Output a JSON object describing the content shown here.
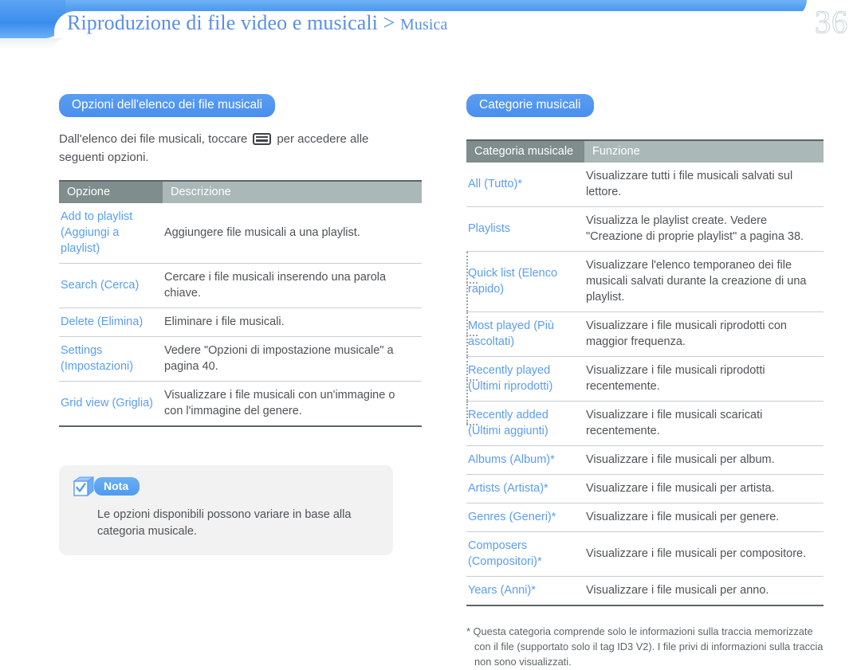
{
  "header": {
    "breadcrumb_main": "Riproduzione di file video e musicali > ",
    "breadcrumb_sub": "Musica",
    "page_number": "36"
  },
  "left": {
    "section_title": "Opzioni dell'elenco dei file musicali",
    "intro_before": "Dall'elenco dei file musicali, toccare",
    "intro_after": "per accedere alle seguenti opzioni.",
    "menu_icon_name": "options-menu-icon",
    "table": {
      "headers": [
        "Opzione",
        "Descrizione"
      ],
      "rows": [
        {
          "key": "Add to playlist (Aggiungi a playlist)",
          "value": "Aggiungere file musicali a una playlist."
        },
        {
          "key": "Search (Cerca)",
          "value": "Cercare i file musicali inserendo una parola chiave."
        },
        {
          "key": "Delete (Elimina)",
          "value": "Eliminare i file musicali."
        },
        {
          "key": "Settings (Impostazioni)",
          "value": "Vedere \"Opzioni di impostazione musicale\" a pagina  40."
        },
        {
          "key": "Grid view (Griglia)",
          "value": "Visualizzare i file musicali con un'immagine o con l'immagine del genere."
        }
      ]
    },
    "note": {
      "icon_name": "note-cube-check-icon",
      "label": "Nota",
      "text": "Le opzioni disponibili possono variare in base alla categoria musicale."
    }
  },
  "right": {
    "section_title": "Categorie musicali",
    "table": {
      "headers": [
        "Categoria musicale",
        "Funzione"
      ],
      "rows": [
        {
          "key": "All (Tutto)*",
          "value": "Visualizzare tutti i file musicali salvati sul lettore.",
          "level": 0
        },
        {
          "key": "Playlists",
          "value": "Visualizza le playlist create. Vedere \"Creazione di proprie playlist\" a pagina 38.",
          "level": 0
        },
        {
          "key": "Quick list (Elenco rapido)",
          "value": "Visualizzare l'elenco temporaneo dei file musicali salvati durante la creazione di una playlist.",
          "level": 1
        },
        {
          "key": "Most played (Più ascoltati)",
          "value": "Visualizzare i file musicali riprodotti con maggior frequenza.",
          "level": 1
        },
        {
          "key": "Recently played (Ultimi riprodotti)",
          "value": "Visualizzare i file musicali riprodotti recentemente.",
          "level": 1
        },
        {
          "key": "Recently added (Ultimi aggiunti)",
          "value": "Visualizzare i file musicali scaricati recentemente.",
          "level": 1,
          "last_sub": true
        },
        {
          "key": "Albums (Album)*",
          "value": "Visualizzare i file musicali per album.",
          "level": 0
        },
        {
          "key": "Artists (Artista)*",
          "value": "Visualizzare i file musicali per artista.",
          "level": 0
        },
        {
          "key": "Genres (Generi)*",
          "value": "Visualizzare i file musicali per genere.",
          "level": 0
        },
        {
          "key": "Composers (Compositori)*",
          "value": "Visualizzare i file musicali per compositore.",
          "level": 0
        },
        {
          "key": "Years (Anni)*",
          "value": "Visualizzare i file musicali per anno.",
          "level": 0
        }
      ]
    },
    "footnote": "* Questa categoria comprende solo le informazioni sulla traccia memorizzate con il file (supportato solo il tag ID3 V2). I file privi di informazioni sulla traccia non sono visualizzati."
  },
  "colors": {
    "accent_blue": "#5a9df2",
    "header_dark": "#7f8d8c",
    "header_light": "#aab8b7",
    "body_text": "#4e5256",
    "rule": "#5c6366"
  }
}
